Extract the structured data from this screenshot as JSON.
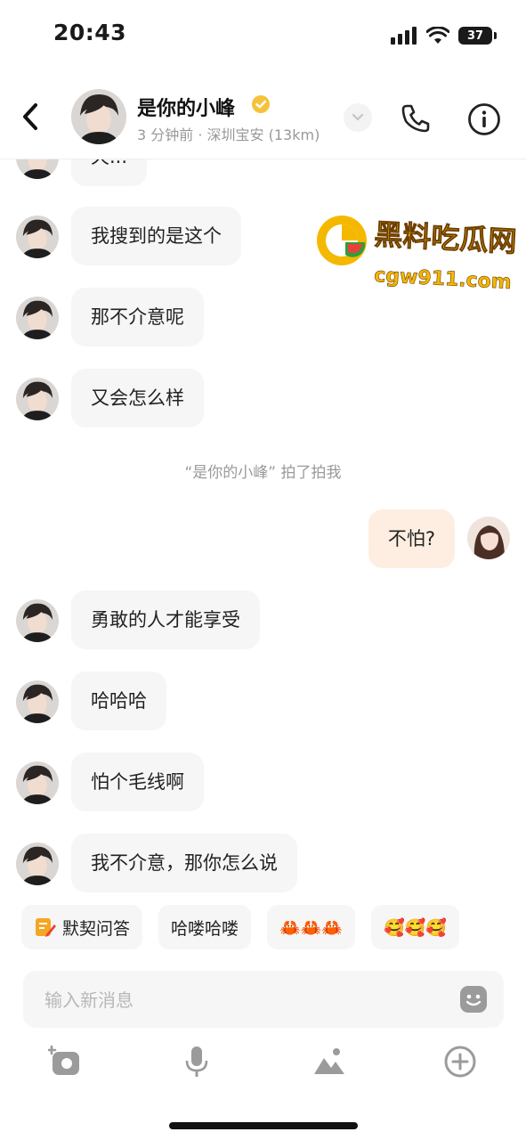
{
  "status_bar": {
    "time": "20:43",
    "battery": "37"
  },
  "header": {
    "contact_name": "是你的小峰",
    "subtitle": "3 分钟前 · 深圳宝安 (13km)"
  },
  "messages": [
    {
      "side": "in",
      "text": "天..."
    },
    {
      "side": "in",
      "text": "我搜到的是这个"
    },
    {
      "side": "in",
      "text": "那不介意呢"
    },
    {
      "side": "in",
      "text": "又会怎么样"
    },
    {
      "side": "system",
      "text": "“是你的小峰” 拍了拍我"
    },
    {
      "side": "out",
      "text": "不怕?"
    },
    {
      "side": "in",
      "text": "勇敢的人才能享受"
    },
    {
      "side": "in",
      "text": "哈哈哈"
    },
    {
      "side": "in",
      "text": "怕个毛线啊"
    },
    {
      "side": "in",
      "text": "我不介意，那你怎么说"
    }
  ],
  "watermark": {
    "title": "黑料吃瓜网",
    "url": "cgw911.com"
  },
  "quick_replies": [
    {
      "label": "默契问答",
      "icon": "pencil-note-icon"
    },
    {
      "label": "哈喽哈喽"
    },
    {
      "label": "🦀🦀🦀"
    },
    {
      "label": "🥰🥰🥰"
    }
  ],
  "composer": {
    "placeholder": "输入新消息"
  },
  "colors": {
    "accent": "#f5c33b",
    "outgoing_bubble": "#fdeee1",
    "incoming_bubble": "#f6f6f6"
  }
}
